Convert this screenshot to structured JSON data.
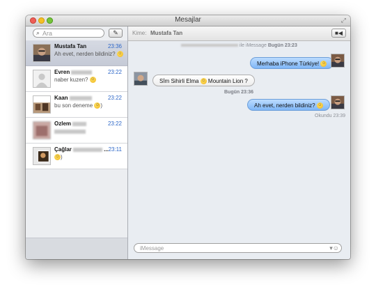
{
  "window": {
    "title": "Mesajlar"
  },
  "sidebar": {
    "search_placeholder": "Ara",
    "conversations": [
      {
        "name": "Mustafa Tan",
        "time": "23:36",
        "snippet": "Ah evet, nerden bildiniz?"
      },
      {
        "name": "Evren",
        "time": "23:22",
        "snippet": "naber kuzen?"
      },
      {
        "name": "Kaan",
        "time": "23:22",
        "snippet": "bu son deneme"
      },
      {
        "name": "Ozlem",
        "time": "23:22",
        "snippet": ""
      },
      {
        "name": "Çağlar",
        "time": "23:11",
        "snippet": ""
      }
    ]
  },
  "chat": {
    "to_label": "Kime:",
    "to_name": "Mustafa Tan",
    "stamp1_prefix": "ile iMessage",
    "stamp1_bold": "Bugün 23:23",
    "stamp2": "Bugün 23:36",
    "messages": [
      {
        "text": "Merhaba iPhone Türkiye!"
      },
      {
        "text": "Sİm Sihirli Elma",
        "suffix": "Mountain Lion ?"
      },
      {
        "text": "Ah evet, nerden bildiniz?"
      }
    ],
    "read_label": "Okundu",
    "read_time": "23:39",
    "input_placeholder": "iMessage"
  },
  "colors": {
    "accent_blue": "#2d67c8",
    "bubble_out": "#9cc8fb"
  }
}
